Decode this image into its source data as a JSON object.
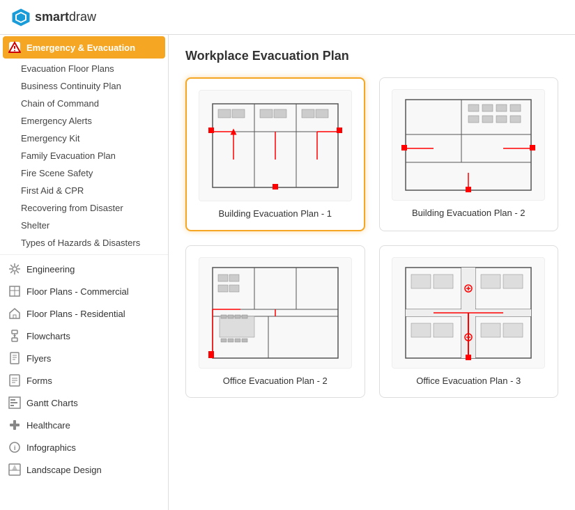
{
  "header": {
    "logo_smart": "smart",
    "logo_draw": "draw"
  },
  "sidebar": {
    "active_category": "Emergency & Evacuation",
    "categories": [
      {
        "id": "emergency",
        "label": "Emergency & Evacuation",
        "active": true,
        "icon": "warning-icon",
        "sub_items": [
          "Evacuation Floor Plans",
          "Business Continuity Plan",
          "Chain of Command",
          "Emergency Alerts",
          "Emergency Kit",
          "Family Evacuation Plan",
          "Fire Scene Safety",
          "First Aid & CPR",
          "Recovering from Disaster",
          "Shelter",
          "Types of Hazards & Disasters"
        ]
      },
      {
        "id": "engineering",
        "label": "Engineering",
        "icon": "engineering-icon"
      },
      {
        "id": "floor-commercial",
        "label": "Floor Plans - Commercial",
        "icon": "floor-commercial-icon"
      },
      {
        "id": "floor-residential",
        "label": "Floor Plans - Residential",
        "icon": "floor-residential-icon"
      },
      {
        "id": "flowcharts",
        "label": "Flowcharts",
        "icon": "flowchart-icon"
      },
      {
        "id": "flyers",
        "label": "Flyers",
        "icon": "flyers-icon"
      },
      {
        "id": "forms",
        "label": "Forms",
        "icon": "forms-icon"
      },
      {
        "id": "gantt",
        "label": "Gantt Charts",
        "icon": "gantt-icon"
      },
      {
        "id": "healthcare",
        "label": "Healthcare",
        "icon": "healthcare-icon"
      },
      {
        "id": "infographics",
        "label": "Infographics",
        "icon": "infographics-icon"
      },
      {
        "id": "landscape",
        "label": "Landscape Design",
        "icon": "landscape-icon"
      }
    ]
  },
  "content": {
    "page_title": "Workplace Evacuation Plan",
    "templates": [
      {
        "id": "bep1",
        "label": "Building Evacuation Plan - 1",
        "selected": true
      },
      {
        "id": "bep2",
        "label": "Building Evacuation Plan - 2",
        "selected": false
      },
      {
        "id": "oep2",
        "label": "Office Evacuation Plan - 2",
        "selected": false
      },
      {
        "id": "oep3",
        "label": "Office Evacuation Plan - 3",
        "selected": false
      }
    ]
  },
  "icons": {
    "warning": "⚠",
    "engineering": "⚙",
    "floor_commercial": "🏢",
    "floor_residential": "🏠",
    "flowchart": "◫",
    "flyers": "📄",
    "forms": "📋",
    "gantt": "📊",
    "healthcare": "➕",
    "infographics": "ℹ",
    "landscape": "🌿"
  }
}
